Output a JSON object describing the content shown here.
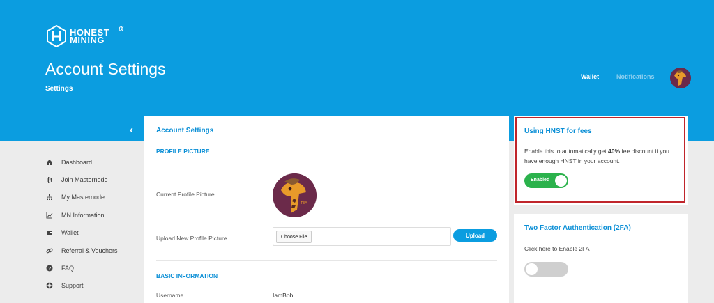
{
  "brand": {
    "line1": "HONEST",
    "line2": "MINING",
    "alpha": "α"
  },
  "header": {
    "title": "Account Settings",
    "subtitle": "Settings",
    "nav": {
      "wallet": "Wallet",
      "notifications": "Notifications"
    },
    "collapse_icon": "chevron-left-icon"
  },
  "sidebar": {
    "items": [
      {
        "label": "Dashboard",
        "icon": "home-icon"
      },
      {
        "label": "Join Masternode",
        "icon": "bitcoin-icon"
      },
      {
        "label": "My Masternode",
        "icon": "network-icon"
      },
      {
        "label": "MN Information",
        "icon": "chart-icon"
      },
      {
        "label": "Wallet",
        "icon": "wallet-icon"
      },
      {
        "label": "Referral & Vouchers",
        "icon": "link-icon"
      },
      {
        "label": "FAQ",
        "icon": "question-icon"
      },
      {
        "label": "Support",
        "icon": "lifebuoy-icon"
      }
    ]
  },
  "main": {
    "title": "Account Settings",
    "profile_section": "PROFILE PICTURE",
    "current_picture_label": "Current Profile Picture",
    "upload_label": "Upload New Profile Picture",
    "choose_file_label": "Choose File",
    "upload_button": "Upload",
    "basic_section": "BASIC INFORMATION",
    "username_label": "Username",
    "username_value": "IamBob"
  },
  "fees": {
    "title": "Using HNST for fees",
    "desc_pre": "Enable this to automatically get ",
    "desc_bold": "40%",
    "desc_post": " fee discount if you have enough HNST in your account.",
    "toggle_label": "Enabled",
    "enabled": true,
    "highlight_color": "#c0252b"
  },
  "twofa": {
    "title": "Two Factor Authentication (2FA)",
    "desc": "Click here to Enable 2FA",
    "enabled": false
  },
  "colors": {
    "primary": "#0b9de0",
    "success": "#2bb24c",
    "background": "#ececec"
  }
}
